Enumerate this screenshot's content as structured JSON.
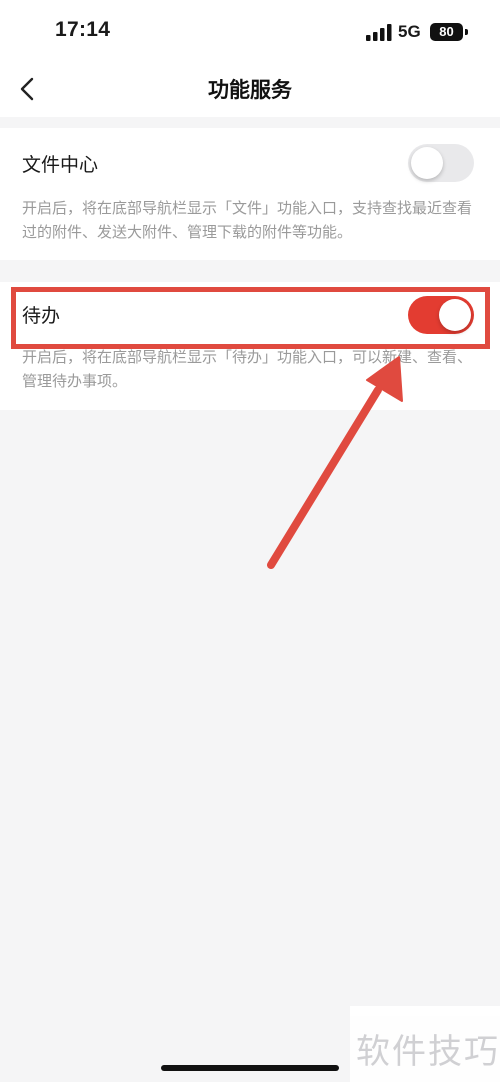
{
  "status_bar": {
    "time": "17:14",
    "network": "5G",
    "battery": "80",
    "icons": [
      "cellular-signal-icon",
      "battery-icon"
    ]
  },
  "nav": {
    "title": "功能服务",
    "back_icon": "chevron-left-icon"
  },
  "settings": [
    {
      "label": "文件中心",
      "enabled": false,
      "description": "开启后，将在底部导航栏显示「文件」功能入口，支持查找最近查看过的附件、发送大附件、管理下载的附件等功能。"
    },
    {
      "label": "待办",
      "enabled": true,
      "description": "开启后，将在底部导航栏显示「待办」功能入口，可以新建、查看、管理待办事项。"
    }
  ],
  "watermark": "软件技巧",
  "colors": {
    "toggle_on": "#e33c31",
    "toggle_off": "#e9e9eb",
    "annotation": "#e04a3f",
    "page_background": "#f5f5f6"
  }
}
